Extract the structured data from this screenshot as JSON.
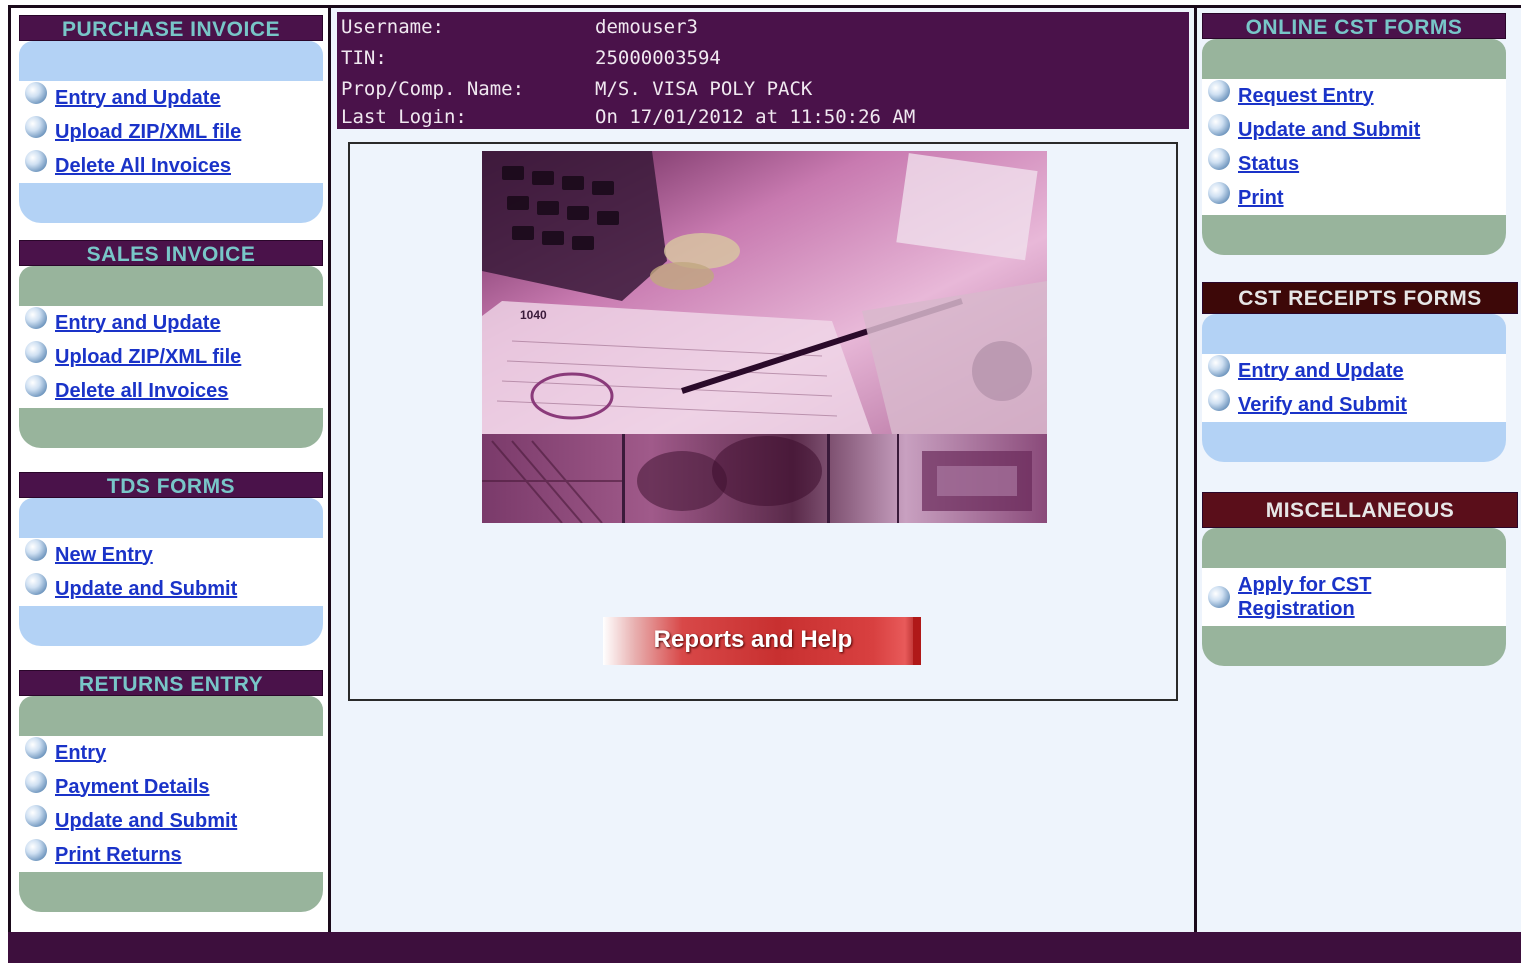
{
  "user_info": {
    "rows": [
      {
        "label": "Username:",
        "value": "demouser3"
      },
      {
        "label": "TIN:",
        "value": "25000003594"
      },
      {
        "label": "Prop/Comp. Name:",
        "value": "M/S. VISA POLY PACK"
      },
      {
        "label": "Last Login:",
        "value": "On 17/01/2012 at 11:50:26 AM"
      }
    ]
  },
  "left_panels": {
    "purchase_invoice": {
      "title": "PURCHASE INVOICE",
      "links": [
        "Entry and Update",
        "Upload ZIP/XML file",
        "Delete All Invoices"
      ]
    },
    "sales_invoice": {
      "title": "SALES INVOICE",
      "links": [
        "Entry and Update",
        "Upload ZIP/XML file",
        "Delete all Invoices"
      ]
    },
    "tds_forms": {
      "title": "TDS FORMS",
      "links": [
        "New Entry",
        "Update and Submit"
      ]
    },
    "returns_entry": {
      "title": "RETURNS ENTRY",
      "links": [
        "Entry",
        "Payment Details",
        "Update and Submit",
        "Print Returns"
      ]
    }
  },
  "right_panels": {
    "online_cst_forms": {
      "title": "ONLINE CST FORMS",
      "links": [
        "Request Entry",
        "Update and Submit",
        "Status",
        "Print"
      ]
    },
    "cst_receipts_forms": {
      "title": "CST RECEIPTS FORMS",
      "links": [
        "Entry and Update",
        "Verify and Submit"
      ]
    },
    "miscellaneous": {
      "title": "MISCELLANEOUS",
      "links": [
        "Apply for CST Registration"
      ]
    }
  },
  "center": {
    "reports_button_label": "Reports and Help"
  },
  "colors": {
    "header_purple": "#4a124a",
    "title_teal": "#78c6c8",
    "link_blue": "#1a33c8",
    "cap_blue": "#b3d2f5",
    "cap_green": "#98b49c",
    "button_red": "#c83030"
  },
  "icons": {
    "bullet": "blue-sphere-bullet-icon"
  }
}
